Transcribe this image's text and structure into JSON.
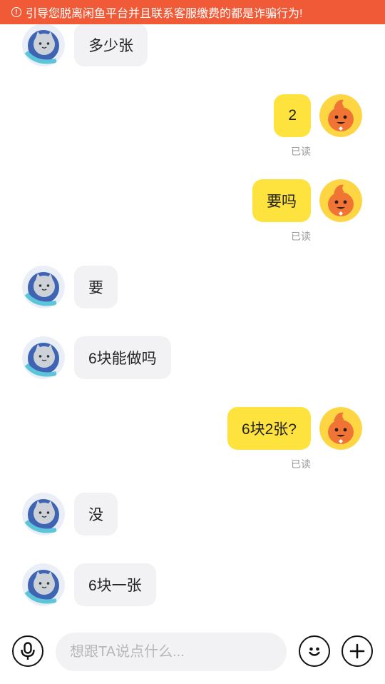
{
  "banner": {
    "icon": "alert-circle-icon",
    "text": "引导您脱离闲鱼平台并且联系客服缴费的都是诈骗行为!"
  },
  "colors": {
    "banner_bg": "#f05a37",
    "my_bubble": "#fee33e",
    "their_bubble": "#f2f2f4",
    "read_text": "#9a9a9a"
  },
  "messages": [
    {
      "side": "left",
      "text": "多少张"
    },
    {
      "side": "right",
      "text": "2",
      "status": "已读"
    },
    {
      "side": "right",
      "text": "要吗",
      "status": "已读"
    },
    {
      "side": "left",
      "text": "要"
    },
    {
      "side": "left",
      "text": "6块能做吗"
    },
    {
      "side": "right",
      "text": "6块2张?",
      "status": "已读"
    },
    {
      "side": "left",
      "text": "没"
    },
    {
      "side": "left",
      "text": "6块一张"
    }
  ],
  "input": {
    "placeholder": "想跟TA说点什么...",
    "value": ""
  },
  "bottom_icons": {
    "voice": "microphone-icon",
    "emoji": "emoji-icon",
    "more": "plus-icon"
  }
}
